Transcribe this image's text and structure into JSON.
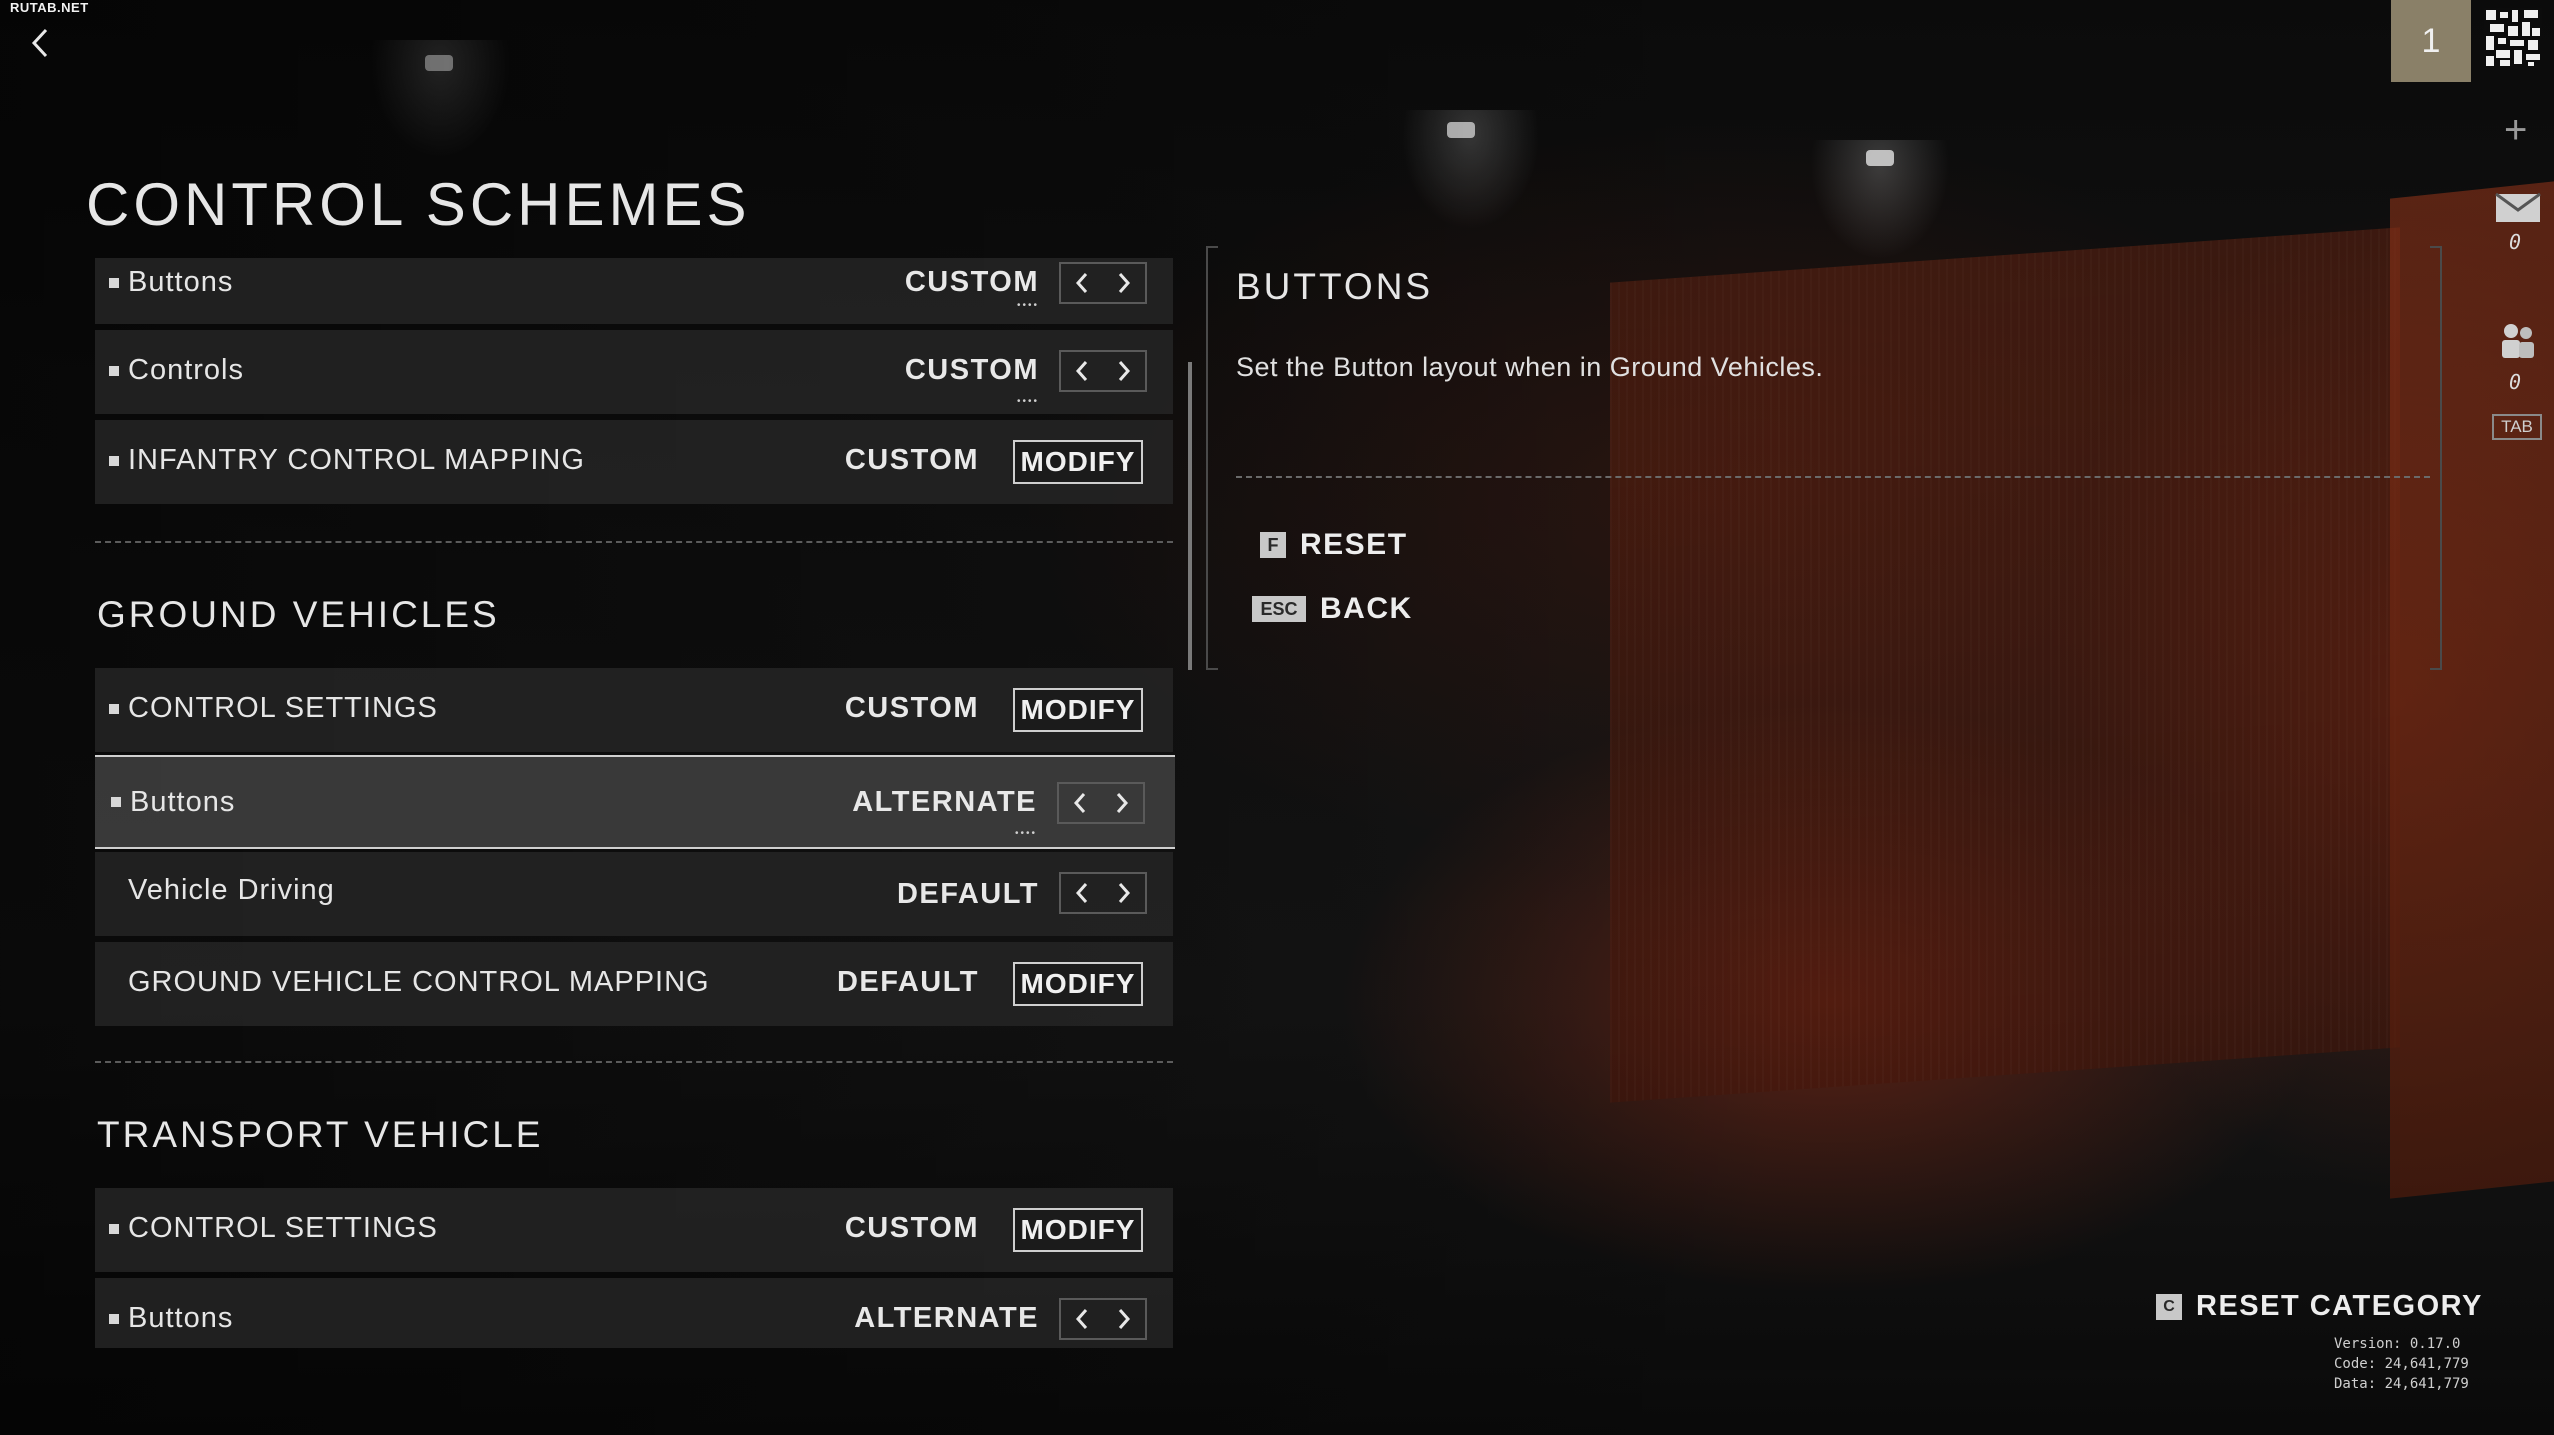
{
  "watermark": "RUTAB.NET",
  "page_title": "CONTROL SCHEMES",
  "settings": {
    "top_rows": [
      {
        "label": "Buttons",
        "value": "CUSTOM",
        "control": "arrows"
      },
      {
        "label": "Controls",
        "value": "CUSTOM",
        "control": "arrows"
      },
      {
        "label": "INFANTRY CONTROL MAPPING",
        "value": "CUSTOM",
        "control": "modify"
      }
    ],
    "ground_vehicles": {
      "title": "GROUND VEHICLES",
      "rows": [
        {
          "label": "CONTROL SETTINGS",
          "value": "CUSTOM",
          "control": "modify"
        },
        {
          "label": "Buttons",
          "value": "ALTERNATE",
          "control": "arrows",
          "selected": true
        },
        {
          "label": "Vehicle Driving",
          "value": "DEFAULT",
          "control": "arrows"
        },
        {
          "label": "GROUND VEHICLE CONTROL MAPPING",
          "value": "DEFAULT",
          "control": "modify"
        }
      ]
    },
    "transport_vehicle": {
      "title": "TRANSPORT VEHICLE",
      "rows": [
        {
          "label": "CONTROL SETTINGS",
          "value": "CUSTOM",
          "control": "modify"
        },
        {
          "label": "Buttons",
          "value": "ALTERNATE",
          "control": "arrows"
        }
      ]
    },
    "modify_label": "MODIFY",
    "dots": "••••"
  },
  "info_panel": {
    "title": "BUTTONS",
    "description": "Set the Button layout when in Ground Vehicles.",
    "reset_key": "F",
    "reset_label": "RESET",
    "back_key": "ESC",
    "back_label": "BACK"
  },
  "side": {
    "player_number": "1",
    "mail_count": "0",
    "friends_count": "0",
    "tab_label": "TAB"
  },
  "footer": {
    "reset_category_key": "C",
    "reset_category_label": "RESET CATEGORY",
    "version": "Version: 0.17.0",
    "code": "Code: 24,641,779",
    "data": "Data: 24,641,779"
  },
  "colors": {
    "accent_player": "#8a8068",
    "row_bg": "#262626",
    "selected_border": "#cfcfcf"
  },
  "icons": [
    "back-arrow-icon",
    "qr-code-icon",
    "plus-icon",
    "mail-icon",
    "friends-icon",
    "chevron-left-icon",
    "chevron-right-icon"
  ]
}
